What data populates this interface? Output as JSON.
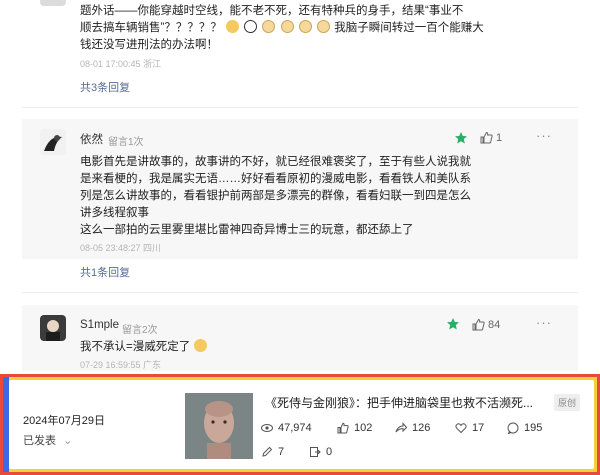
{
  "comment_top": {
    "lines": [
      "题外话——你能穿越时空线，能不老不死，还有特种兵的身手，结果“事业不",
      "顺去搞车辆销售”？？？？？"
    ],
    "line2_tail": "我脑子瞬间转过一百个能赚大",
    "line3": "钱还没写进刑法的办法啊！",
    "meta": "08-01 17:00:45 浙江",
    "replies": "共3条回复"
  },
  "comment_2": {
    "name": "依然",
    "reply_label": "留言1次",
    "like_count": "1",
    "lines": [
      "电影首先是讲故事的，故事讲的不好，就已经很难褒奖了，至于有些人说我就",
      "是来看梗的，我是属实无语……好好看看原初的漫威电影，看看铁人和美队系",
      "列是怎么讲故事的，看看银护前两部是多漂亮的群像，看看妇联一到四是怎么",
      "讲多线程叙事",
      "这么一部拍的云里雾里堪比雷神四奇异博士三的玩意，都还舔上了"
    ],
    "meta": "08-05 23:48:27 四川",
    "replies": "共1条回复"
  },
  "comment_3": {
    "name": "S1mple",
    "reply_label": "留言2次",
    "like_count": "84",
    "text": "我不承认=漫威死定了",
    "meta": "07-29 16:59:55 广东"
  },
  "article": {
    "date": "2024年07月29日",
    "status": "已发表",
    "title": "《死侍与金刚狼》：把手伸进脑袋里也救不活濒死...",
    "badge": "原创",
    "stats": {
      "views": "47,974",
      "likes": "102",
      "shares": "126",
      "favorites": "17",
      "comments": "195",
      "edits": "7",
      "reposts": "0"
    }
  },
  "colors": {
    "accent_green": "#2aae67",
    "link_blue": "#576b95",
    "frame_red": "#e84a3b",
    "frame_yellow": "#f5d03a",
    "frame_blue": "#3b6be0"
  }
}
